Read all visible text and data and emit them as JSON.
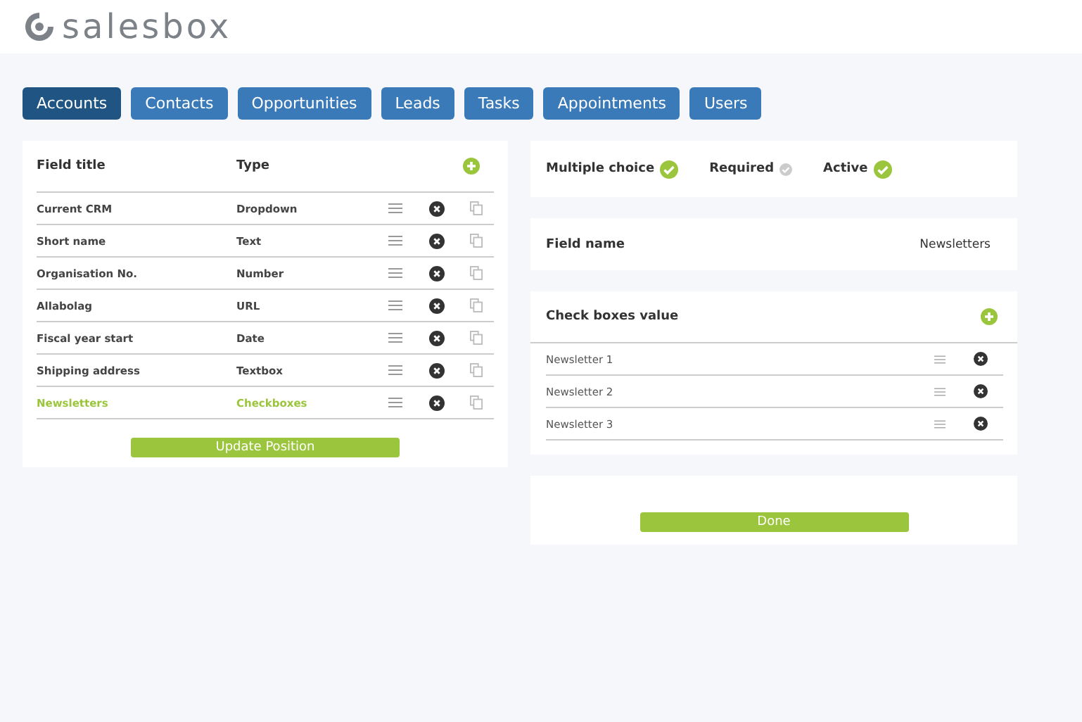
{
  "logo": {
    "text": "salesbox"
  },
  "tabs": [
    {
      "label": "Accounts",
      "selected": true
    },
    {
      "label": "Contacts",
      "selected": false
    },
    {
      "label": "Opportunities",
      "selected": false
    },
    {
      "label": "Leads",
      "selected": false
    },
    {
      "label": "Tasks",
      "selected": false
    },
    {
      "label": "Appointments",
      "selected": false
    },
    {
      "label": "Users",
      "selected": false
    }
  ],
  "fields_table": {
    "columns": [
      "Field title",
      "Type"
    ],
    "rows": [
      {
        "title": "Current CRM",
        "type": "Dropdown",
        "selected": false
      },
      {
        "title": "Short name",
        "type": "Text",
        "selected": false
      },
      {
        "title": "Organisation No.",
        "type": "Number",
        "selected": false
      },
      {
        "title": "Allabolag",
        "type": "URL",
        "selected": false
      },
      {
        "title": "Fiscal year start",
        "type": "Date",
        "selected": false
      },
      {
        "title": "Shipping address",
        "type": "Textbox",
        "selected": false
      },
      {
        "title": "Newsletters",
        "type": "Checkboxes",
        "selected": true
      }
    ],
    "button": "Update Position"
  },
  "options": [
    {
      "label": "Multiple choice",
      "checked": true
    },
    {
      "label": "Required",
      "checked": false
    },
    {
      "label": "Active",
      "checked": true
    }
  ],
  "field_name": {
    "label": "Field name",
    "value": "Newsletters"
  },
  "checkbox_values": {
    "title": "Check boxes value",
    "items": [
      "Newsletter 1",
      "Newsletter 2",
      "Newsletter 3"
    ]
  },
  "done_button": "Done"
}
